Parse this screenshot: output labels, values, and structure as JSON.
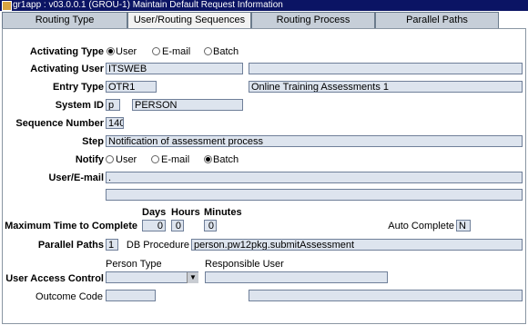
{
  "window": {
    "title": "gr1app : v03.0.0.1  (GROU-1) Maintain Default Request Information"
  },
  "tabs": [
    {
      "label": "Routing Type"
    },
    {
      "label": "User/Routing Sequences"
    },
    {
      "label": "Routing Process Instructions"
    },
    {
      "label": "Parallel Paths"
    }
  ],
  "form": {
    "activating_type": {
      "label": "Activating Type",
      "options": [
        "User",
        "E-mail",
        "Batch"
      ],
      "selected": "User"
    },
    "activating_user": {
      "label": "Activating User",
      "value": "ITSWEB",
      "desc": ""
    },
    "entry_type": {
      "label": "Entry Type",
      "value": "OTR1",
      "desc": "Online Training Assessments 1"
    },
    "system_id": {
      "label": "System ID",
      "value": "p",
      "desc": "PERSON"
    },
    "sequence_number": {
      "label": "Sequence Number",
      "value": "140"
    },
    "step": {
      "label": "Step",
      "value": "Notification of assessment process"
    },
    "notify": {
      "label": "Notify",
      "options": [
        "User",
        "E-mail",
        "Batch"
      ],
      "selected": "Batch"
    },
    "user_email": {
      "label": "User/E-mail",
      "value1": ".",
      "value2": ""
    },
    "max_time": {
      "label": "Maximum Time to Complete",
      "days_label": "Days",
      "hours_label": "Hours",
      "minutes_label": "Minutes",
      "days": "0",
      "hours": "0",
      "minutes": "0"
    },
    "auto_complete": {
      "label": "Auto Complete",
      "value": "N"
    },
    "parallel_paths": {
      "label": "Parallel Paths",
      "value": "1"
    },
    "db_procedure": {
      "label": "DB Procedure",
      "value": "person.pw12pkg.submitAssessment"
    },
    "user_access_control": {
      "label": "User Access Control",
      "person_type_label": "Person Type",
      "person_type": "",
      "responsible_user_label": "Responsible User",
      "responsible_user": ""
    },
    "outcome_code": {
      "label": "Outcome Code",
      "value": "",
      "desc": ""
    }
  }
}
